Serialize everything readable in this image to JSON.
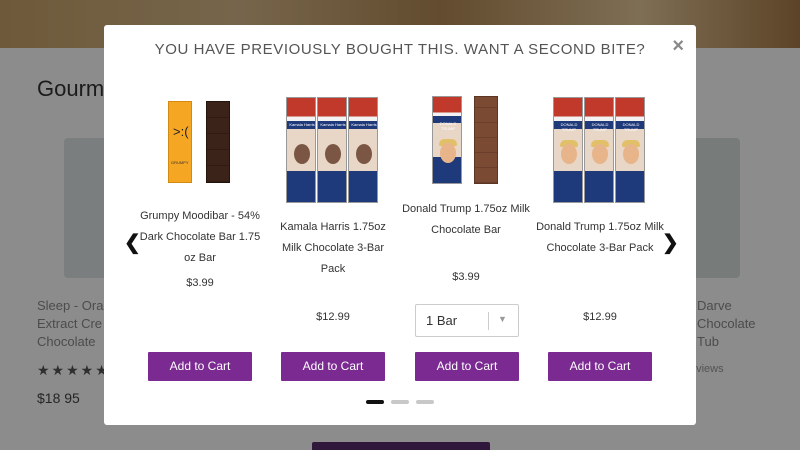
{
  "background": {
    "title": "Gourm",
    "left_product_name": "Sleep - Ora\nExtract Cre\nChocolate",
    "right_product_name": "Darve\nChocolate\nTub",
    "left_price": "$18 95",
    "right_reviews": "eviews",
    "stars": "★★★★★"
  },
  "modal": {
    "title": "YOU HAVE PREVIOUSLY BOUGHT THIS. WANT A SECOND BITE?",
    "close_label": "×",
    "prev_label": "❮",
    "next_label": "❯",
    "products": [
      {
        "name": "Grumpy Moodibar - 54% Dark Chocolate Bar 1.75 oz Bar",
        "price": "$3.99",
        "cart_label": "Add to Cart",
        "wrapper_text": "GRUMPY"
      },
      {
        "name": "Kamala Harris 1.75oz Milk Chocolate 3-Bar Pack",
        "price": "$12.99",
        "cart_label": "Add to Cart",
        "wrapper_text": "Kamala Harris"
      },
      {
        "name": "Donald Trump 1.75oz Milk Chocolate Bar",
        "price": "$3.99",
        "cart_label": "Add to Cart",
        "wrapper_text": "DONALD TRUMP"
      },
      {
        "name": "Donald Trump 1.75oz Milk Chocolate 3-Bar Pack",
        "price": "$12.99",
        "cart_label": "Add to Cart",
        "wrapper_text": "DONALD TRUMP"
      }
    ],
    "quantity_select": {
      "value": "1 Bar"
    },
    "pagination": {
      "pages": 3,
      "active": 0
    }
  },
  "colors": {
    "accent": "#7a2a91",
    "overlay": "rgba(0,0,0,0.45)"
  }
}
